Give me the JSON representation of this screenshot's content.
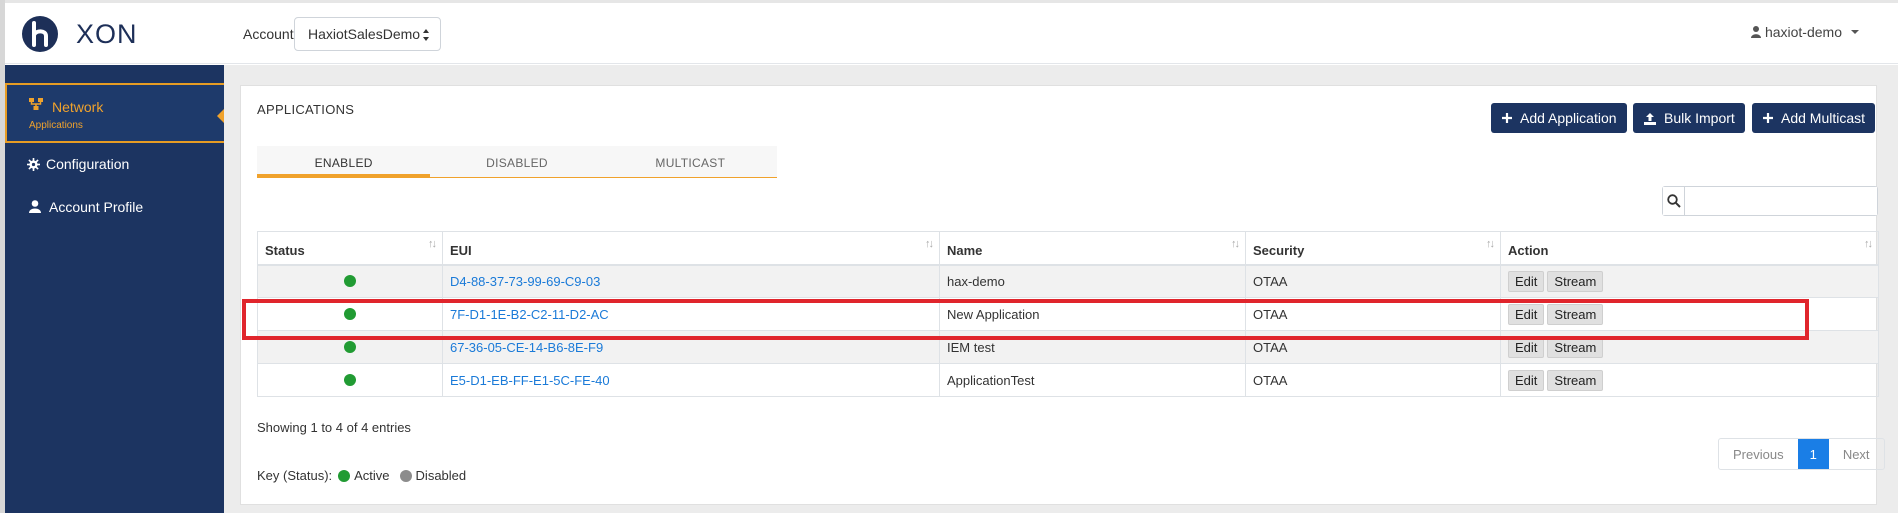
{
  "brand": {
    "logo_text": "XON",
    "logo_letter": "h"
  },
  "header": {
    "account_label": "Account",
    "account_value": "HaxiotSalesDemo",
    "user_name": "haxiot-demo"
  },
  "sidebar": {
    "items": [
      {
        "label": "Network",
        "sub": "Applications"
      },
      {
        "label": "Configuration"
      },
      {
        "label": "Account Profile"
      }
    ]
  },
  "panel": {
    "title": "APPLICATIONS",
    "buttons": {
      "add_application": "Add Application",
      "bulk_import": "Bulk Import",
      "add_multicast": "Add Multicast"
    },
    "tabs": [
      "ENABLED",
      "DISABLED",
      "MULTICAST"
    ],
    "search": {
      "value": ""
    }
  },
  "table": {
    "columns": [
      "Status",
      "EUI",
      "Name",
      "Security",
      "Action"
    ],
    "rows": [
      {
        "eui": "D4-88-37-73-99-69-C9-03",
        "name": "hax-demo",
        "security": "OTAA",
        "status": "active"
      },
      {
        "eui": "7F-D1-1E-B2-C2-11-D2-AC",
        "name": "New Application",
        "security": "OTAA",
        "status": "active"
      },
      {
        "eui": "67-36-05-CE-14-B6-8E-F9",
        "name": "IEM test",
        "security": "OTAA",
        "status": "active"
      },
      {
        "eui": "E5-D1-EB-FF-E1-5C-FE-40",
        "name": "ApplicationTest",
        "security": "OTAA",
        "status": "active"
      }
    ],
    "edit_label": "Edit",
    "stream_label": "Stream"
  },
  "footer": {
    "showing": "Showing 1 to 4 of 4 entries",
    "pagination": {
      "previous": "Previous",
      "current": "1",
      "next": "Next"
    },
    "key_label": "Key (Status):",
    "key_active": "Active",
    "key_disabled": "Disabled"
  },
  "colors": {
    "sidebar": "#1c3461",
    "accent": "#f0a22c",
    "active_status": "#219b33",
    "disabled_status": "#8c8c8c",
    "highlight": "#e0252c",
    "link": "#1a7ad8"
  }
}
